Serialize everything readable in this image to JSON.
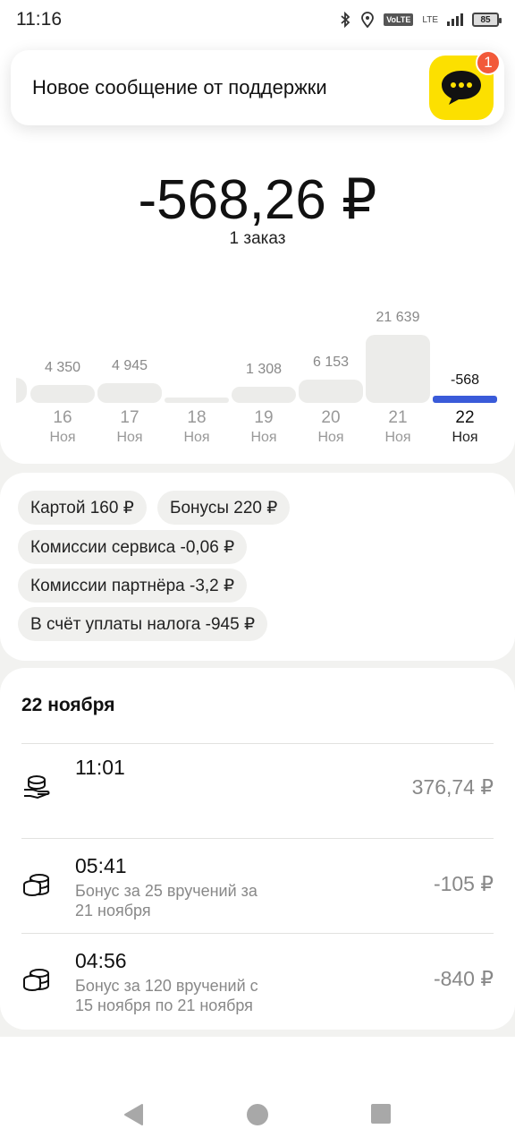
{
  "status_bar": {
    "time": "11:16",
    "volte": "VoLTE",
    "lte": "LTE",
    "battery": "85",
    "icons": [
      "bluetooth-icon",
      "location-icon",
      "signal-icon",
      "battery-icon"
    ]
  },
  "notification": {
    "text": "Новое сообщение от поддержки",
    "badge_count": "1",
    "icon": "chat-bubble-icon",
    "accent": "#fce000"
  },
  "summary": {
    "balance": "-568,26 ₽",
    "orders": "1 заказ"
  },
  "chart_data": {
    "type": "bar",
    "categories": [
      "16",
      "17",
      "18",
      "19",
      "20",
      "21",
      "22"
    ],
    "month_labels": [
      "Ноя",
      "Ноя",
      "Ноя",
      "Ноя",
      "Ноя",
      "Ноя",
      "Ноя"
    ],
    "value_labels": [
      "4 350",
      "4 945",
      "",
      "1 308",
      "6 153",
      "21 639",
      "-568"
    ],
    "values": [
      4350,
      4945,
      0,
      1308,
      6153,
      21639,
      -568
    ],
    "selected": "22",
    "selected_color": "#3a5bd9"
  },
  "breakdown": {
    "chips": [
      "Картой 160 ₽",
      "Бонусы 220 ₽",
      "Комиссии сервиса -0,06 ₽",
      "Комиссии партнёра -3,2 ₽",
      "В счёт уплаты налога -945 ₽"
    ]
  },
  "transactions": {
    "date": "22 ноября",
    "items": [
      {
        "time": "11:01",
        "desc1": "",
        "desc2": "",
        "amount": "376,74 ₽",
        "icon": "coins-hand-icon"
      },
      {
        "time": "05:41",
        "desc1": "Бонус за 25 вручений за",
        "desc2": "21 ноября",
        "amount": "-105 ₽",
        "icon": "coins-icon"
      },
      {
        "time": "04:56",
        "desc1": "Бонус за 120 вручений с",
        "desc2": "15 ноября по 21 ноября",
        "amount": "-840 ₽",
        "icon": "coins-icon"
      }
    ]
  },
  "navigation": {
    "buttons": [
      "back-icon",
      "home-icon",
      "recents-icon"
    ]
  }
}
